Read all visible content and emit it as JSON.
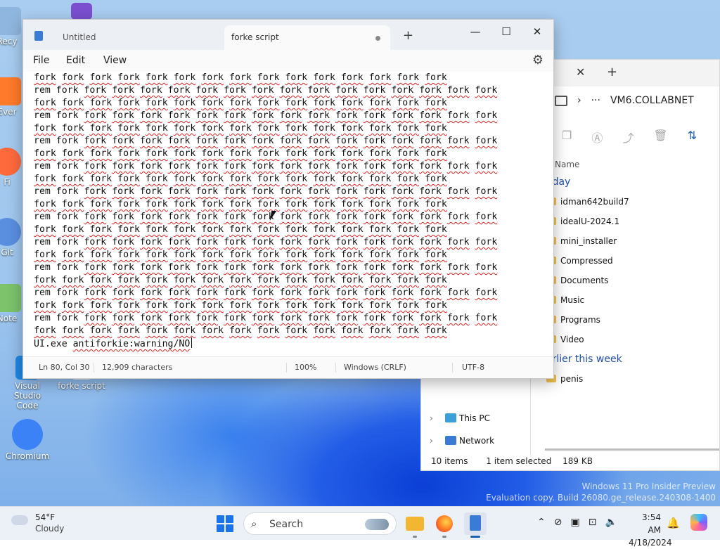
{
  "desktop": {
    "icons": [
      {
        "label": "Recy",
        "color": "#4a90d9"
      },
      {
        "label": "Ever",
        "color": "#3aa0ff"
      },
      {
        "label": "Fi",
        "color": "#ff6a3d"
      },
      {
        "label": "Git",
        "color": "#5a8fe0"
      },
      {
        "label": "Note",
        "color": "#7cc36b"
      },
      {
        "label": "Visual Studio Code",
        "color": "#1e88e5"
      },
      {
        "label": "forke script",
        "color": "#e9eef5"
      },
      {
        "label": "Chromium",
        "color": "#3b82f6"
      }
    ],
    "watermark_line1": "Windows 11 Pro Insider Preview",
    "watermark_line2": "Evaluation copy. Build 26080.ge_release.240308-1400"
  },
  "explorer": {
    "address": "VM6.COLLABNET",
    "more": "···",
    "column_name": "Name",
    "group_today": "oday",
    "group_earlier": "arlier this week",
    "files_today": [
      "idman642build7",
      "idealU-2024.1",
      "mini_installer",
      "Compressed",
      "Documents",
      "Music",
      "Programs",
      "Video"
    ],
    "files_earlier": [
      "penis"
    ],
    "nav": [
      {
        "label": "This PC",
        "color": "#3aa0d8"
      },
      {
        "label": "Network",
        "color": "#3a7bd5"
      }
    ],
    "status_items": "10 items",
    "status_selected": "1 item selected",
    "status_size": "189 KB"
  },
  "notepad": {
    "tab_untitled": "Untitled",
    "tab_active": "forke script",
    "menu_file": "File",
    "menu_edit": "Edit",
    "menu_view": "View",
    "first_line_count": 15,
    "repeated_groups": 10,
    "rem_line_count": 16,
    "cont_line_count": 15,
    "word": "fork",
    "rem_prefix": "rem",
    "last_line_cmd": "UI.exe",
    "last_line_arg": "antiforkie:warning/NO",
    "status_position": "Ln 80, Col 30",
    "status_chars": "12,909 characters",
    "status_zoom": "100%",
    "status_eol": "Windows (CRLF)",
    "status_encoding": "UTF-8"
  },
  "taskbar": {
    "temp": "54°F",
    "condition": "Cloudy",
    "search_label": "Search",
    "time": "3:54 AM",
    "date": "4/18/2024",
    "apps": [
      {
        "name": "file-explorer",
        "color": "#f2b632"
      },
      {
        "name": "firefox",
        "color": "#ff6d1f"
      },
      {
        "name": "notepad",
        "color": "#3a7bd5"
      }
    ]
  }
}
